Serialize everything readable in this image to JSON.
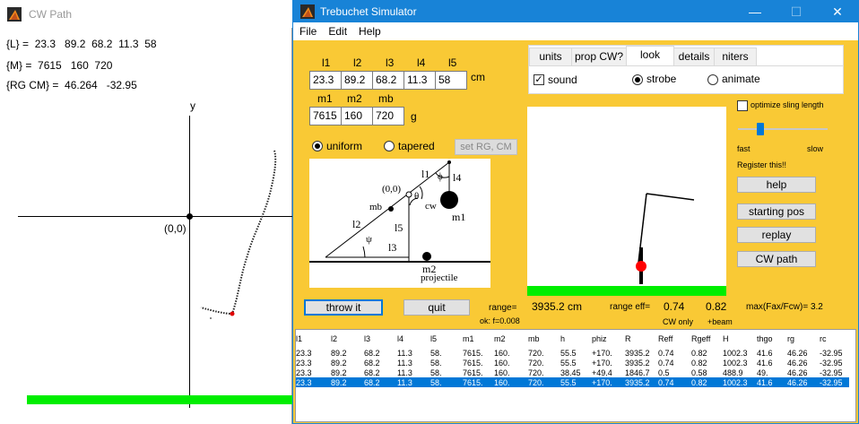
{
  "cw_window": {
    "title": "CW Path",
    "L_line": "{L} =  23.3   89.2  68.2  11.3  58",
    "M_line": "{M} =  7615   160  720",
    "RG_line": "{RG CM} =  46.264   -32.95",
    "axis_y": "y",
    "origin": "(0,0)"
  },
  "app": {
    "title": "Trebuchet Simulator",
    "menu": [
      "File",
      "Edit",
      "Help"
    ],
    "window_controls": {
      "minimize": "—",
      "maximize": "☐",
      "close": "✕"
    }
  },
  "lengths": {
    "headers": [
      "l1",
      "l2",
      "l3",
      "l4",
      "l5"
    ],
    "values": [
      "23.3",
      "89.2",
      "68.2",
      "11.3",
      "58"
    ],
    "unit": "cm"
  },
  "masses": {
    "headers": [
      "m1",
      "m2",
      "mb"
    ],
    "values": [
      "7615",
      "160",
      "720"
    ],
    "unit": "g"
  },
  "beam": {
    "uniform_label": "uniform",
    "tapered_label": "tapered",
    "selected": "uniform",
    "set_rg_label": "set RG, CM"
  },
  "diagram": {
    "origin": "(0,0)",
    "l1": "l1",
    "phi": "ϕ",
    "l4": "l4",
    "theta": "θ",
    "mb": "mb",
    "cw": "cw",
    "m1": "m1",
    "l2": "l2",
    "l5": "l5",
    "psi": "ψ",
    "l3": "l3",
    "m2": "m2",
    "projectile": "projectile"
  },
  "tabs": {
    "items": [
      "units",
      "prop CW?",
      "look",
      "details",
      "niters"
    ],
    "active": "look",
    "sound_label": "sound",
    "sound_checked": true,
    "strobe_label": "strobe",
    "animate_label": "animate",
    "selected_mode": "strobe"
  },
  "controls": {
    "optimize_label": "optimize sling length",
    "fast_label": "fast",
    "slow_label": "slow",
    "register_label": "Register this!!",
    "help_button": "help",
    "starting_pos_button": "starting pos",
    "replay_button": "replay",
    "cw_path_button": "CW path",
    "throw_button": "throw it",
    "quit_button": "quit",
    "speed_level": 0.25
  },
  "readouts": {
    "range_label": "range=",
    "range_value": "3935.2  cm",
    "ok_label": "ok:  f=0.008",
    "range_eff_label": "range  eff=",
    "eff_cw": "0.74",
    "eff_beam": "0.82",
    "cw_only_label": "CW only",
    "beam_label": "+beam",
    "max_ratio": "max(Fax/Fcw)=  3.2"
  },
  "results": {
    "columns": [
      "l1",
      "l2",
      "l3",
      "l4",
      "l5",
      "m1",
      "m2",
      "mb",
      "h",
      "phiz",
      "R",
      "Reff",
      "Rgeff",
      "H",
      "thgo",
      "rg",
      "rc"
    ],
    "rows": [
      [
        "23.3",
        "89.2",
        "68.2",
        "11.3",
        "58.",
        "7615.",
        "160.",
        "720.",
        "55.5",
        "+170.",
        "3935.2",
        "0.74",
        "0.82",
        "1002.3",
        "41.6",
        "46.26",
        "-32.95"
      ],
      [
        "23.3",
        "89.2",
        "68.2",
        "11.3",
        "58.",
        "7615.",
        "160.",
        "720.",
        "55.5",
        "+170.",
        "3935.2",
        "0.74",
        "0.82",
        "1002.3",
        "41.6",
        "46.26",
        "-32.95"
      ],
      [
        "23.3",
        "89.2",
        "68.2",
        "11.3",
        "58.",
        "7615.",
        "160.",
        "720.",
        "38.45",
        "+49.4",
        "1846.7",
        "0.5",
        "0.58",
        "488.9",
        "49.",
        "46.26",
        "-32.95"
      ],
      [
        "23.3",
        "89.2",
        "68.2",
        "11.3",
        "58.",
        "7615.",
        "160.",
        "720.",
        "55.5",
        "+170.",
        "3935.2",
        "0.74",
        "0.82",
        "1002.3",
        "41.6",
        "46.26",
        "-32.95"
      ]
    ],
    "selected_row": 3
  },
  "colors": {
    "panel": "#f9c935",
    "titlebar": "#1883d7",
    "ground": "#00ee00",
    "projectile": "#ff0000",
    "selection": "#0078d7"
  }
}
